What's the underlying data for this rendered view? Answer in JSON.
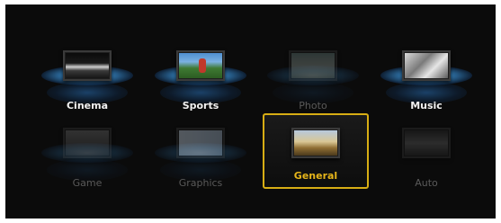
{
  "modes": [
    {
      "id": "cinema",
      "label": "Cinema",
      "state": "active",
      "icon": "tv-cinema-icon"
    },
    {
      "id": "sports",
      "label": "Sports",
      "state": "active",
      "icon": "tv-sports-icon"
    },
    {
      "id": "photo",
      "label": "Photo",
      "state": "disabled",
      "icon": "tv-photo-icon"
    },
    {
      "id": "music",
      "label": "Music",
      "state": "active",
      "icon": "tv-music-icon"
    },
    {
      "id": "game",
      "label": "Game",
      "state": "disabled",
      "icon": "tv-game-icon"
    },
    {
      "id": "graphics",
      "label": "Graphics",
      "state": "disabled",
      "icon": "tv-graphics-icon"
    },
    {
      "id": "general",
      "label": "General",
      "state": "selected",
      "icon": "tv-general-icon"
    },
    {
      "id": "auto",
      "label": "Auto",
      "state": "disabled",
      "icon": "tv-auto-icon"
    }
  ],
  "colors": {
    "selection_border": "#d7ad14",
    "selected_label": "#e5b41a",
    "active_label": "#f2f2f2",
    "disabled_label": "#5a5a5a",
    "glow": "#4aa3e6",
    "background": "#0b0b0b"
  }
}
